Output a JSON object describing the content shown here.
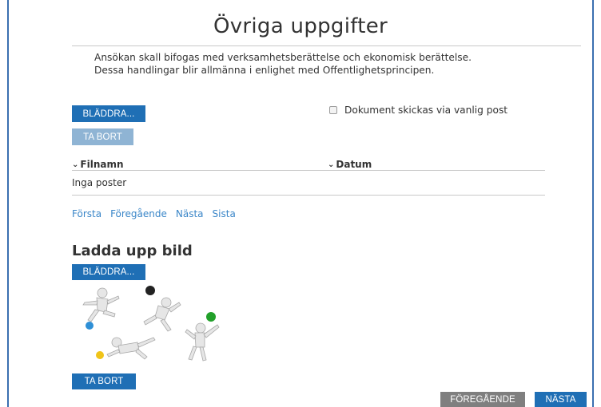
{
  "page": {
    "title": "Övriga uppgifter",
    "description_line1": "Ansökan skall bifogas med verksamhetsberättelse och ekonomisk berättelse.",
    "description_line2": "Dessa handlingar blir allmänna i enlighet med Offentlighetsprincipen."
  },
  "attachments": {
    "browse_label": "BLÄDDRA...",
    "remove_label": "TA BORT",
    "post_checkbox_label": "Dokument skickas via vanlig post",
    "post_checkbox_checked": false,
    "columns": [
      "Filnamn",
      "Datum"
    ],
    "empty_text": "Inga poster",
    "pager": [
      "Första",
      "Föregående",
      "Nästa",
      "Sista"
    ]
  },
  "image_upload": {
    "section_title": "Ladda upp bild",
    "browse_label": "BLÄDDRA...",
    "remove_label": "TA BORT",
    "image_icon": "sports-figures-image"
  },
  "footer": {
    "previous_label": "FÖREGÅENDE",
    "next_label": "NÄSTA"
  },
  "colors": {
    "primary": "#1f6fb5",
    "disabled": "#8fb4d4",
    "gray": "#7f7f7f",
    "link": "#3a86c8",
    "frame": "#3a6fb0"
  }
}
